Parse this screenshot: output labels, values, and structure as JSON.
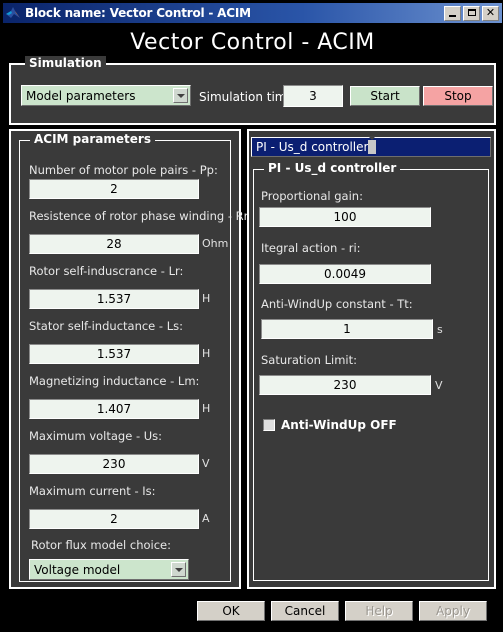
{
  "window": {
    "title": "Block name: Vector Control - ACIM",
    "app_icon": "matlab-logo-icon",
    "minimize_label": "_",
    "maximize_label": "□",
    "close_label": "✕"
  },
  "header": {
    "title": "Vector Control - ACIM"
  },
  "simulation": {
    "legend": "Simulation",
    "mode_select": {
      "value": "Model parameters",
      "icon": "chevron-down-icon"
    },
    "sim_time_label": "Simulation time:",
    "sim_time_value": "3",
    "start_label": "Start",
    "stop_label": "Stop",
    "start_color": "#c9e3c9",
    "stop_color": "#f5a3a3"
  },
  "acim_panel": {
    "legend": "ACIM parameters",
    "fields": [
      {
        "label": "Number of motor pole pairs - Pp:",
        "value": "2",
        "unit": ""
      },
      {
        "label": "Resistence of rotor phase winding - Rr:",
        "value": "28",
        "unit": "Ohm"
      },
      {
        "label": "Rotor self-induscrance - Lr:",
        "value": "1.537",
        "unit": "H"
      },
      {
        "label": "Stator self-inductance - Ls:",
        "value": "1.537",
        "unit": "H"
      },
      {
        "label": "Magnetizing inductance - Lm:",
        "value": "1.407",
        "unit": "H"
      },
      {
        "label": "Maximum voltage - Us:",
        "value": "230",
        "unit": "V"
      },
      {
        "label": "Maximum current - Is:",
        "value": "2",
        "unit": "A"
      }
    ],
    "flux_model_label": "Rotor flux model choice:",
    "flux_model_value": "Voltage model",
    "flux_model_icon": "chevron-down-icon"
  },
  "controller_panel": {
    "selector_value": "PI - Us_d controller",
    "selector_icon": "chevron-down-icon",
    "legend": "PI - Us_d controller",
    "fields": [
      {
        "label": "Proportional gain:",
        "value": "100",
        "unit": ""
      },
      {
        "label": "Itegral action - ri:",
        "value": "0.0049",
        "unit": ""
      },
      {
        "label": "Anti-WindUp constant - Tt:",
        "value": "1",
        "unit": "s"
      },
      {
        "label": "Saturation Limit:",
        "value": "230",
        "unit": "V"
      }
    ],
    "checkbox_label": "Anti-WindUp OFF",
    "checkbox_checked": false
  },
  "footer": {
    "ok_label": "OK",
    "cancel_label": "Cancel",
    "help_label": "Help",
    "apply_label": "Apply",
    "help_enabled": false,
    "apply_enabled": false
  }
}
